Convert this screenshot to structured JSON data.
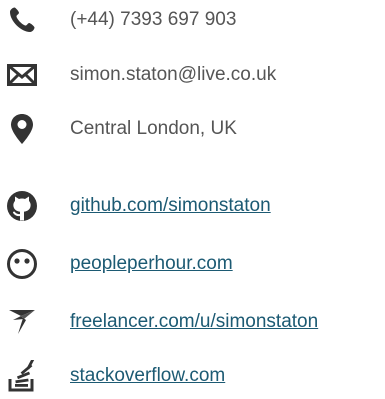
{
  "colors": {
    "icon": "#333333",
    "text": "#555555",
    "link": "#1c5a73"
  },
  "contacts": [
    {
      "icon": "phone-icon",
      "label": "(+44) 7393 697 903",
      "is_link": false
    },
    {
      "icon": "envelope-icon",
      "label": "simon.staton@live.co.uk",
      "is_link": false
    },
    {
      "icon": "map-marker-icon",
      "label": "Central London, UK",
      "is_link": false
    },
    {
      "icon": "github-icon",
      "label": "github.com/simonstaton",
      "is_link": true
    },
    {
      "icon": "peopleperhour-icon",
      "label": "peopleperhour.com",
      "is_link": true
    },
    {
      "icon": "freelancer-icon",
      "label": "freelancer.com/u/simonstaton",
      "is_link": true
    },
    {
      "icon": "stackoverflow-icon",
      "label": "stackoverflow.com",
      "is_link": true
    }
  ]
}
